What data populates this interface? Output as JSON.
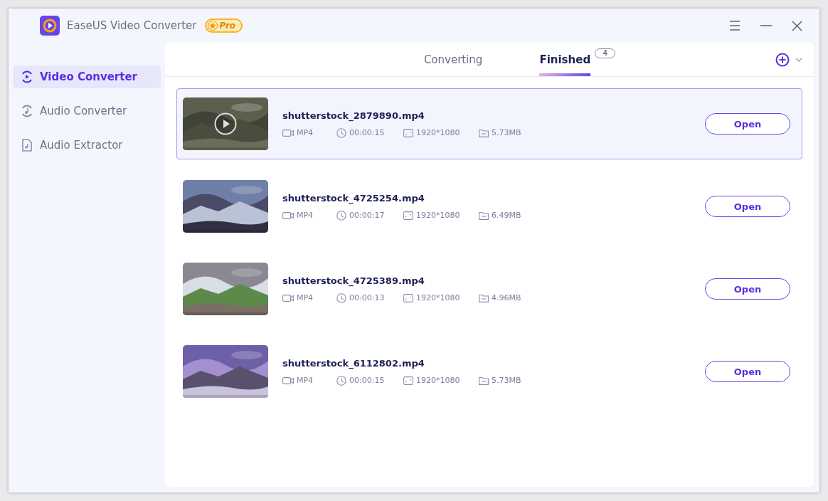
{
  "window": {
    "title": "EaseUS Video Converter",
    "badge": "Pro"
  },
  "sidebar": {
    "items": [
      {
        "label": "Video Converter",
        "kind": "video",
        "selected": true
      },
      {
        "label": "Audio Converter",
        "kind": "audio",
        "selected": false
      },
      {
        "label": "Audio Extractor",
        "kind": "extract",
        "selected": false
      }
    ]
  },
  "tabs": [
    {
      "label": "Converting",
      "selected": false
    },
    {
      "label": "Finished",
      "selected": true,
      "count": "4"
    }
  ],
  "files": [
    {
      "name": "shutterstock_2879890.mp4",
      "format": "MP4",
      "duration": "00:00:15",
      "resolution": "1920*1080",
      "size": "5.73MB",
      "selected": true,
      "button": "Open"
    },
    {
      "name": "shutterstock_4725254.mp4",
      "format": "MP4",
      "duration": "00:00:17",
      "resolution": "1920*1080",
      "size": "6.49MB",
      "selected": false,
      "button": "Open"
    },
    {
      "name": "shutterstock_4725389.mp4",
      "format": "MP4",
      "duration": "00:00:13",
      "resolution": "1920*1080",
      "size": "4.96MB",
      "selected": false,
      "button": "Open"
    },
    {
      "name": "shutterstock_6112802.mp4",
      "format": "MP4",
      "duration": "00:00:15",
      "resolution": "1920*1080",
      "size": "5.73MB",
      "selected": false,
      "button": "Open"
    }
  ]
}
